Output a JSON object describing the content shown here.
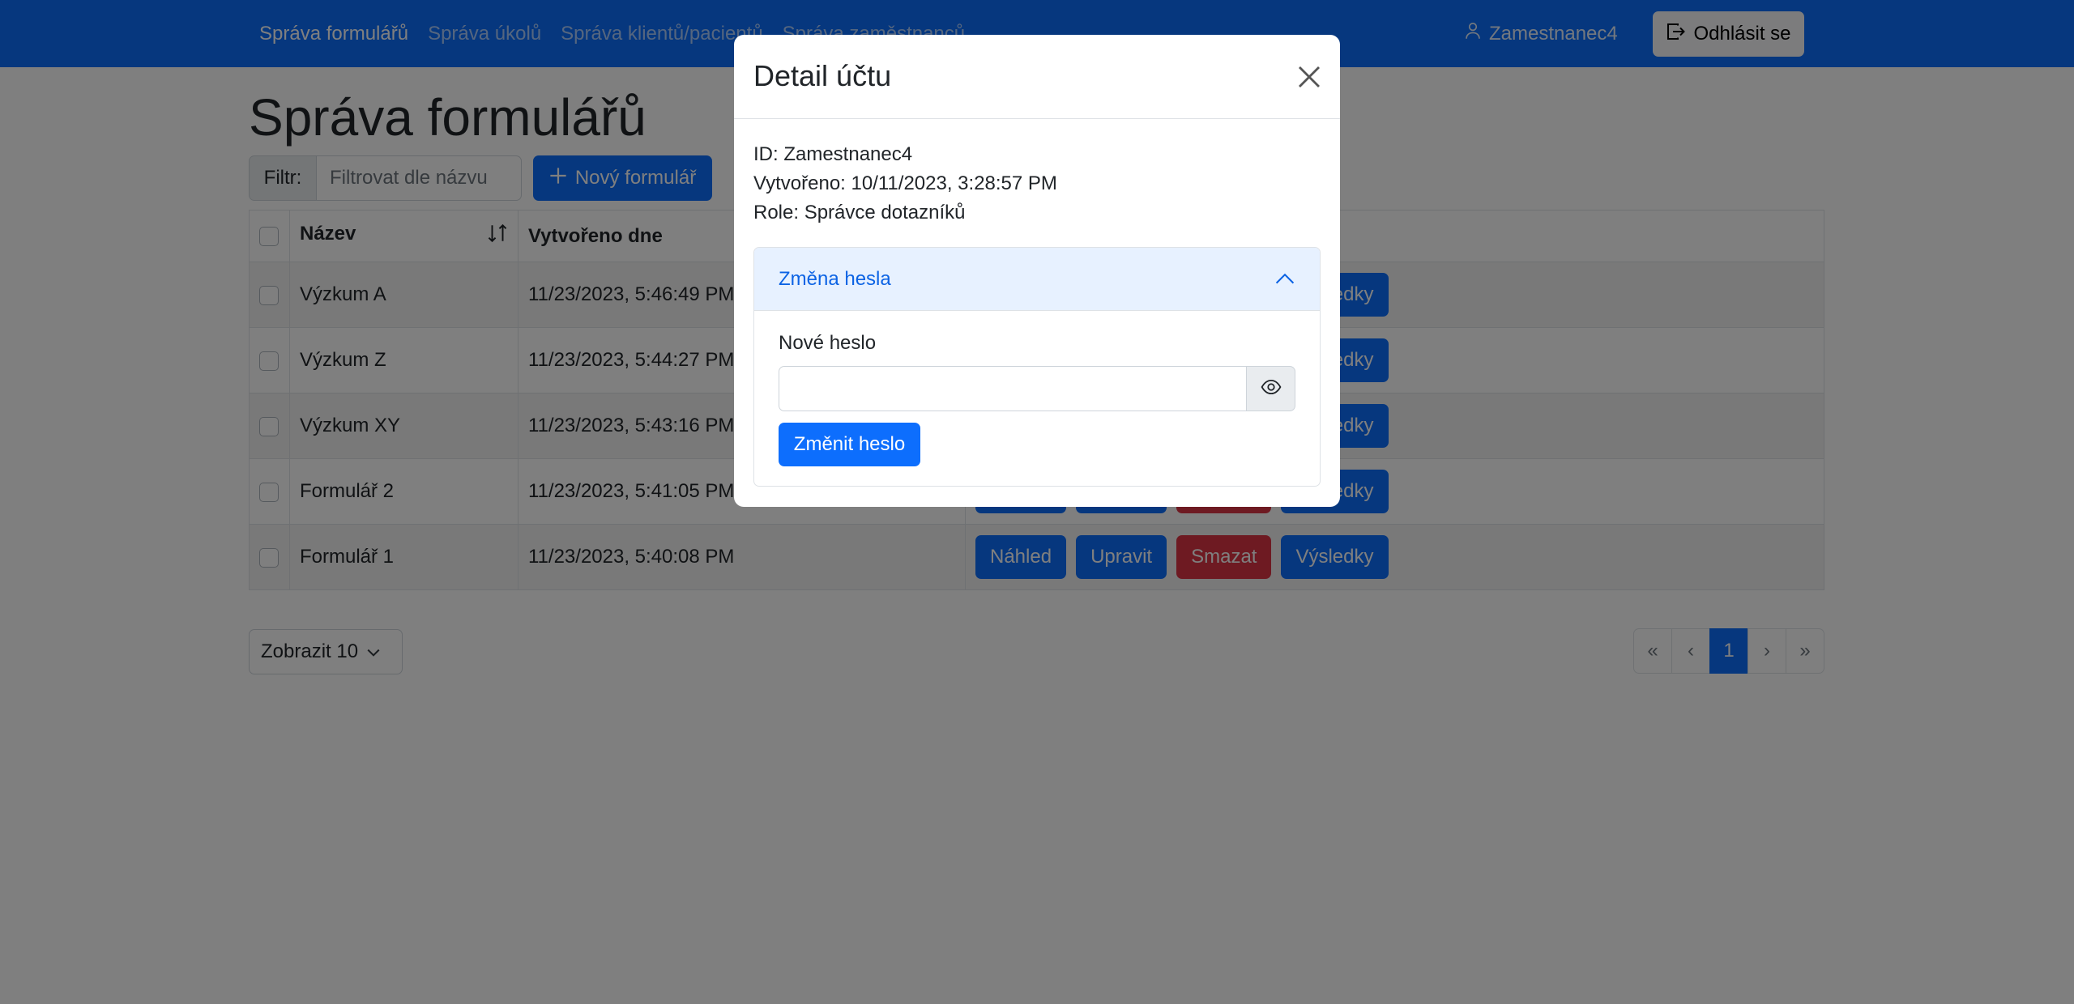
{
  "navbar": {
    "links": [
      {
        "label": "Správa formulářů",
        "active": true
      },
      {
        "label": "Správa úkolů",
        "active": false
      },
      {
        "label": "Správa klientů/pacientů",
        "active": false
      },
      {
        "label": "Správa zaměstnanců",
        "active": false
      }
    ],
    "user_name": "Zamestnanec4",
    "user_icon": "person-icon",
    "logout_label": "Odhlásit se",
    "logout_icon": "logout-icon"
  },
  "page": {
    "title": "Správa formulářů",
    "filter_label": "Filtr:",
    "filter_placeholder": "Filtrovat dle názvu",
    "filter_value": "",
    "new_form_label": "Nový formulář",
    "new_form_icon": "plus-icon"
  },
  "table": {
    "headers": {
      "name": "Název",
      "created": "Vytvořeno dne",
      "sort_icon": "sort-arrows-icon"
    },
    "rows": [
      {
        "name": "Výzkum A",
        "created": "11/23/2023, 5:46:49 PM"
      },
      {
        "name": "Výzkum Z",
        "created": "11/23/2023, 5:44:27 PM"
      },
      {
        "name": "Výzkum XY",
        "created": "11/23/2023, 5:43:16 PM"
      },
      {
        "name": "Formulář 2",
        "created": "11/23/2023, 5:41:05 PM"
      },
      {
        "name": "Formulář 1",
        "created": "11/23/2023, 5:40:08 PM"
      }
    ],
    "actions": {
      "preview": "Náhled",
      "edit": "Upravit",
      "delete": "Smazat",
      "results": "Výsledky"
    }
  },
  "footer": {
    "page_size_label": "Zobrazit 10",
    "pagination": [
      "«",
      "‹",
      "1",
      "›",
      "»"
    ],
    "current_page": "1"
  },
  "modal": {
    "title": "Detail účtu",
    "id_line": "ID: Zamestnanec4",
    "created_line": "Vytvořeno: 10/11/2023, 3:28:57 PM",
    "role_line": "Role: Správce dotazníků",
    "accordion_title": "Změna hesla",
    "new_password_label": "Nové heslo",
    "new_password_value": "",
    "change_password_label": "Změnit heslo"
  },
  "colors": {
    "primary": "#0d6efd",
    "danger": "#dc3545",
    "backdrop": "rgba(0,0,0,0.5)",
    "accordion_active_bg": "#e7f1ff"
  }
}
